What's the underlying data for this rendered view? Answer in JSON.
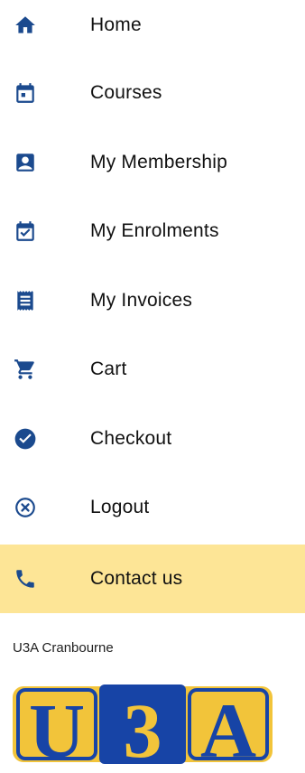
{
  "nav": {
    "items": [
      {
        "label": "Home",
        "icon": "home-icon"
      },
      {
        "label": "Courses",
        "icon": "calendar-icon"
      },
      {
        "label": "My Membership",
        "icon": "id-badge-icon"
      },
      {
        "label": "My Enrolments",
        "icon": "calendar-check-icon"
      },
      {
        "label": "My Invoices",
        "icon": "receipt-icon"
      },
      {
        "label": "Cart",
        "icon": "shopping-cart-icon"
      },
      {
        "label": "Checkout",
        "icon": "check-circle-icon"
      },
      {
        "label": "Logout",
        "icon": "close-circle-icon"
      },
      {
        "label": "Contact us",
        "icon": "phone-icon"
      }
    ],
    "active_item": "Contact us"
  },
  "footer": {
    "org_name": "U3A Cranbourne",
    "logo_text": "U3A"
  },
  "colors": {
    "icon": "#1b4a8e",
    "active_background": "#fde596",
    "logo_yellow": "#f2c43a",
    "logo_blue": "#1744a6"
  }
}
